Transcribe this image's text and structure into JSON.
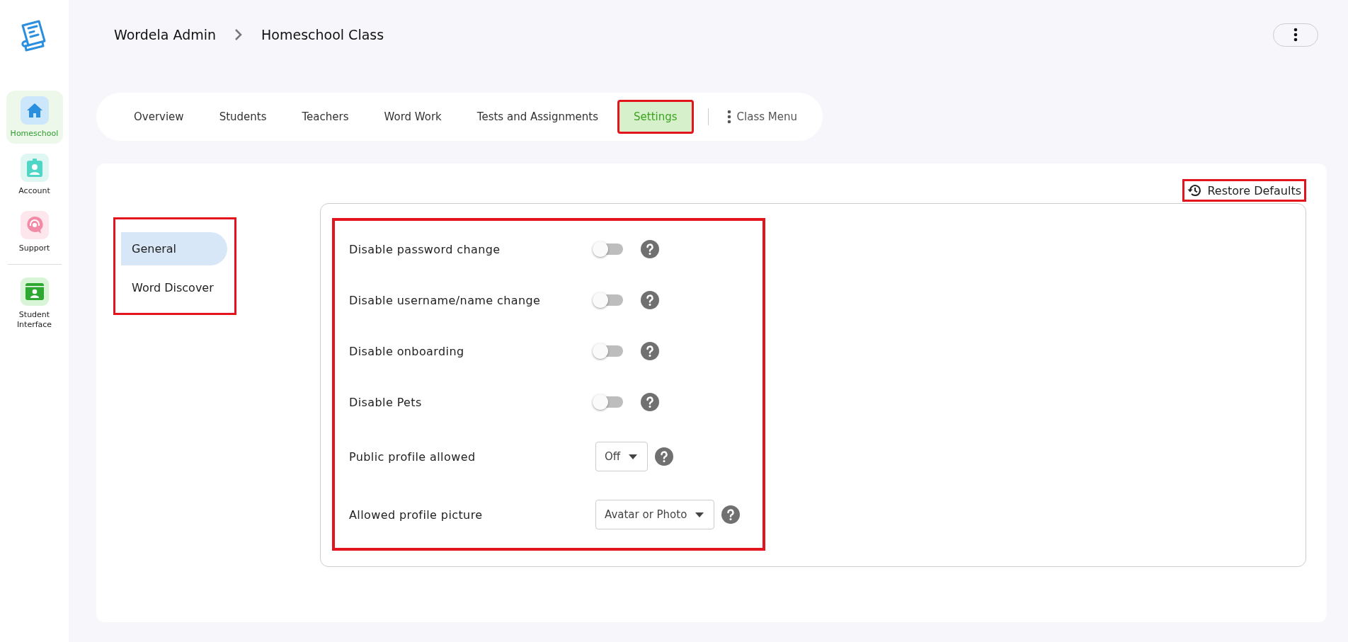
{
  "sidebar": {
    "items": [
      {
        "label": "Homeschool",
        "kind": "home",
        "selected": true
      },
      {
        "label": "Account",
        "kind": "account",
        "selected": false
      },
      {
        "label": "Support",
        "kind": "support",
        "selected": false
      },
      {
        "label": "Student Interface",
        "kind": "student",
        "selected": false
      }
    ]
  },
  "breadcrumb": [
    "Wordela Admin",
    "Homeschool Class"
  ],
  "tabs": [
    {
      "label": "Overview",
      "selected": false,
      "highlighted": false
    },
    {
      "label": "Students",
      "selected": false,
      "highlighted": false
    },
    {
      "label": "Teachers",
      "selected": false,
      "highlighted": false
    },
    {
      "label": "Word Work",
      "selected": false,
      "highlighted": false
    },
    {
      "label": "Tests and Assignments",
      "selected": false,
      "highlighted": false
    },
    {
      "label": "Settings",
      "selected": true,
      "highlighted": true
    }
  ],
  "class_menu": {
    "label": "Class Menu"
  },
  "restore_button": {
    "label": "Restore Defaults",
    "highlighted": true
  },
  "sub_nav": {
    "highlighted": true,
    "items": [
      {
        "label": "General",
        "selected": true
      },
      {
        "label": "Word Discover",
        "selected": false
      }
    ]
  },
  "settings": {
    "highlighted": true,
    "rows": [
      {
        "label": "Disable password change",
        "kind": "toggle",
        "on": false
      },
      {
        "label": "Disable username/name change",
        "kind": "toggle",
        "on": false
      },
      {
        "label": "Disable onboarding",
        "kind": "toggle",
        "on": false
      },
      {
        "label": "Disable Pets",
        "kind": "toggle",
        "on": false
      },
      {
        "label": "Public profile allowed",
        "kind": "select",
        "value": "Off"
      },
      {
        "label": "Allowed profile picture",
        "kind": "select",
        "value": "Avatar or Photo"
      }
    ]
  }
}
